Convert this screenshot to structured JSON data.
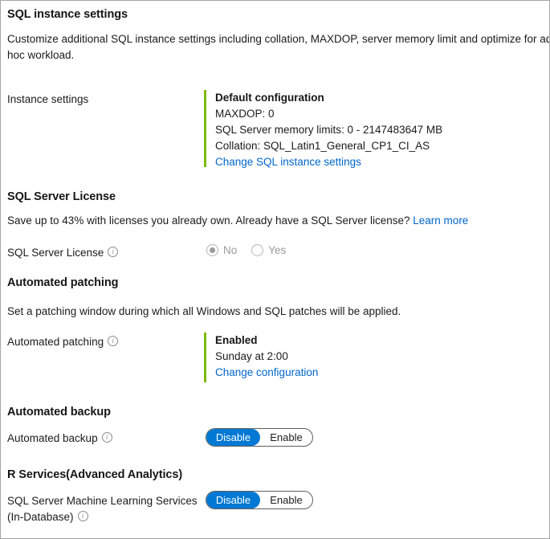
{
  "panel": {
    "title": "SQL instance settings",
    "description": "Customize additional SQL instance settings including collation, MAXDOP, server memory limit and optimize for ad-hoc workload."
  },
  "colors": {
    "accent_green": "#7cb900",
    "link_blue": "#0066cc",
    "toggle_blue": "#0078d4",
    "disabled_grey": "#9a9a9a"
  },
  "instance_settings": {
    "label": "Instance settings",
    "config_title": "Default configuration",
    "maxdop": "MAXDOP: 0",
    "memory_limits": "SQL Server memory limits: 0 - 2147483647 MB",
    "collation": "Collation: SQL_Latin1_General_CP1_CI_AS",
    "change_link": "Change SQL instance settings"
  },
  "sql_server_license": {
    "heading": "SQL Server License",
    "description_text": "Save up to 43% with licenses you already own. Already have a SQL Server license? ",
    "learn_more": "Learn more",
    "field_label": "SQL Server License",
    "options": [
      {
        "label": "No",
        "selected": true
      },
      {
        "label": "Yes",
        "selected": false
      }
    ],
    "info_icon": "info-icon"
  },
  "automated_patching": {
    "heading": "Automated patching",
    "description": "Set a patching window during which all Windows and SQL patches will be applied.",
    "field_label": "Automated patching",
    "status_title": "Enabled",
    "schedule": "Sunday at 2:00",
    "change_link": "Change configuration",
    "info_icon": "info-icon"
  },
  "automated_backup": {
    "heading": "Automated backup",
    "field_label": "Automated backup",
    "info_icon": "info-icon",
    "toggle": {
      "disable_label": "Disable",
      "enable_label": "Enable",
      "selected": "Disable"
    }
  },
  "r_services": {
    "heading": "R Services(Advanced Analytics)",
    "field_label_line1": "SQL Server Machine Learning Services",
    "field_label_line2": "(In-Database)",
    "info_icon": "info-icon",
    "toggle": {
      "disable_label": "Disable",
      "enable_label": "Enable",
      "selected": "Disable"
    }
  }
}
